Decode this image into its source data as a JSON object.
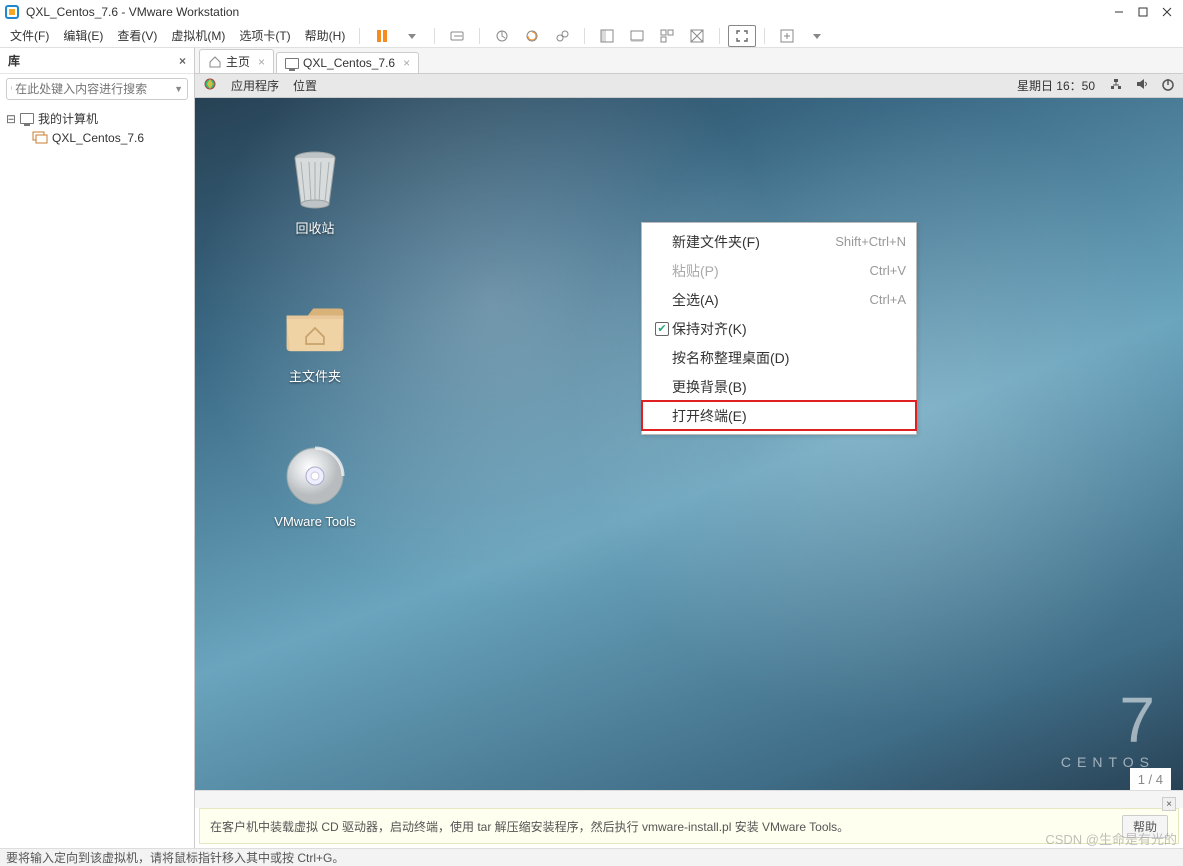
{
  "window": {
    "title": "QXL_Centos_7.6 - VMware Workstation",
    "minimize": "–",
    "maximize": "□",
    "close": "×"
  },
  "menubar": {
    "items": [
      "文件(F)",
      "编辑(E)",
      "查看(V)",
      "虚拟机(M)",
      "选项卡(T)",
      "帮助(H)"
    ]
  },
  "sidebar": {
    "title": "库",
    "search_placeholder": "在此处键入内容进行搜索",
    "dropdown_glyph": "▼",
    "tree": {
      "root": "我的计算机",
      "child": "QXL_Centos_7.6"
    }
  },
  "tabs": [
    {
      "icon": "home",
      "label": "主页"
    },
    {
      "icon": "monitor",
      "label": "QXL_Centos_7.6"
    }
  ],
  "guestbar": {
    "apps": "应用程序",
    "places": "位置",
    "clock": "星期日 16：50"
  },
  "desktop_icons": {
    "trash": "回收站",
    "home": "主文件夹",
    "vmtools": "VMware Tools"
  },
  "context_menu": [
    {
      "label": "新建文件夹(F)",
      "accel": "Shift+Ctrl+N",
      "checkbox": false
    },
    {
      "label": "粘贴(P)",
      "accel": "Ctrl+V",
      "disabled": true
    },
    {
      "label": "全选(A)",
      "accel": "Ctrl+A"
    },
    {
      "label": "保持对齐(K)",
      "checkbox": true
    },
    {
      "label": "按名称整理桌面(D)"
    },
    {
      "label": "更换背景(B)"
    },
    {
      "label": "打开终端(E)",
      "highlight": true
    }
  ],
  "centos": {
    "big": "7",
    "word": "CENTOS"
  },
  "pagecount": "1 / 4",
  "info": {
    "text": "在客户机中装载虚拟 CD 驱动器，启动终端，使用 tar 解压缩安装程序，然后执行 vmware-install.pl 安装 VMware Tools。",
    "help": "帮助"
  },
  "statusline": "要将输入定向到该虚拟机，请将鼠标指针移入其中或按 Ctrl+G。",
  "watermark": "CSDN @生命是有光的"
}
